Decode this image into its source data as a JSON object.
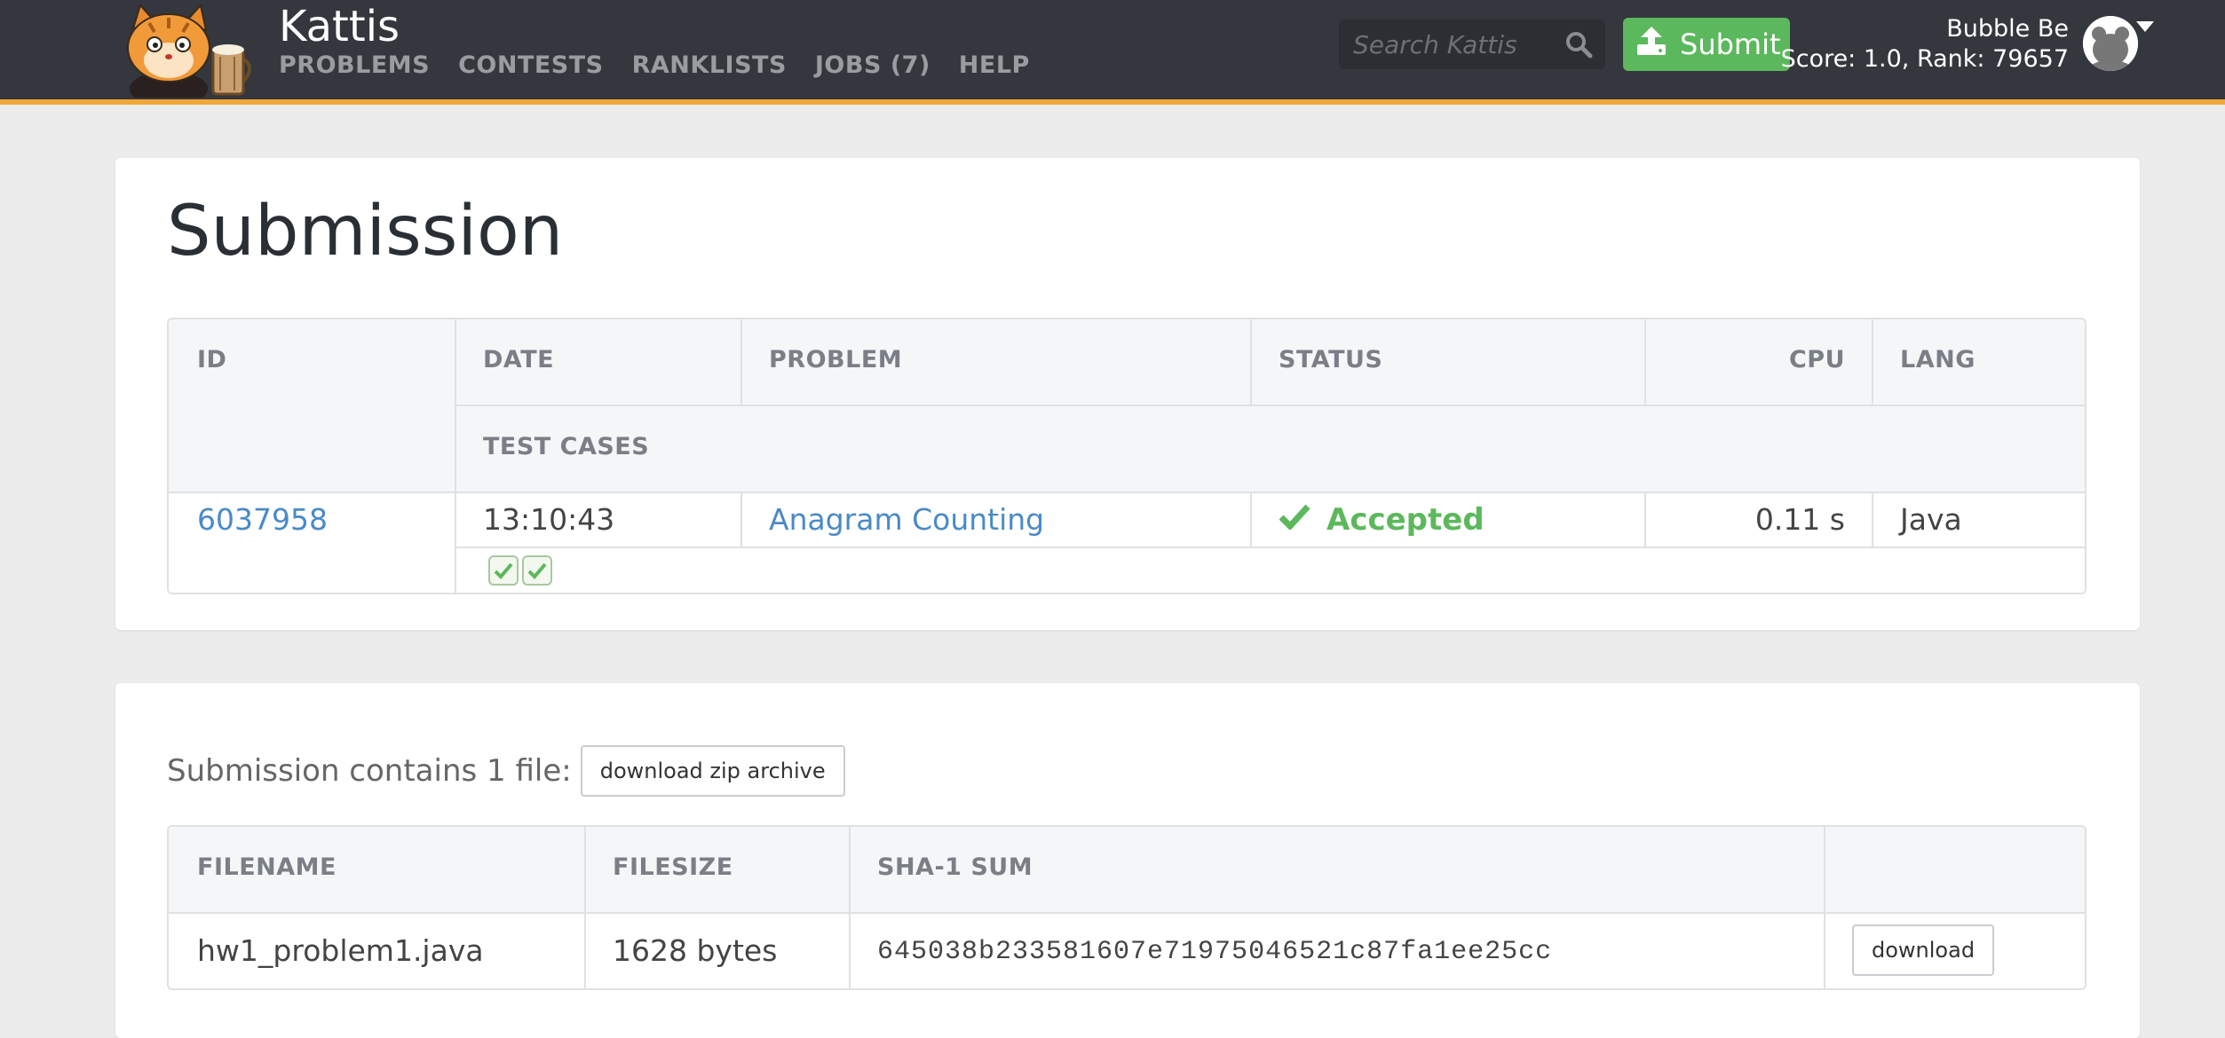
{
  "navbar": {
    "brand": "Kattis",
    "links": [
      "PROBLEMS",
      "CONTESTS",
      "RANKLISTS",
      "JOBS (7)",
      "HELP"
    ],
    "search_placeholder": "Search Kattis",
    "submit_label": "Submit",
    "user_name": "Bubble Be",
    "user_stats": "Score: 1.0, Rank: 79657",
    "accent_color": "#f0a839"
  },
  "submission": {
    "title": "Submission",
    "headers": {
      "id": "ID",
      "date": "DATE",
      "problem": "PROBLEM",
      "status": "STATUS",
      "cpu": "CPU",
      "lang": "LANG",
      "test_cases": "TEST CASES"
    },
    "row": {
      "id": "6037958",
      "date": "13:10:43",
      "problem": "Anagram Counting",
      "status": "Accepted",
      "cpu": "0.11 s",
      "lang": "Java",
      "test_cases_passed": 2,
      "status_color": "#5cb85c"
    }
  },
  "files": {
    "summary": "Submission contains 1 file:",
    "download_zip_label": "download zip archive",
    "headers": {
      "filename": "FILENAME",
      "filesize": "FILESIZE",
      "sha1": "SHA-1 SUM"
    },
    "rows": [
      {
        "filename": "hw1_problem1.java",
        "filesize": "1628 bytes",
        "sha1": "645038b233581607e71975046521c87fa1ee25cc",
        "download_label": "download"
      }
    ]
  }
}
